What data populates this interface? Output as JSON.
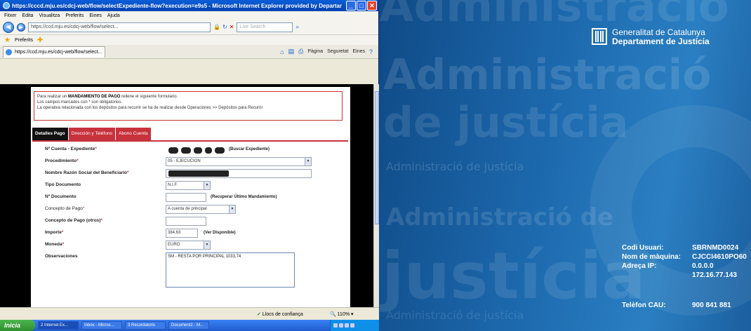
{
  "window": {
    "title": "https://cccd.mju.es/cdcj-web/flow/selectExpediente-flow?execution=e9s5 - Microsoft Internet Explorer provided by Departament de"
  },
  "menu": [
    "Fitxer",
    "Edita",
    "Visualitza",
    "Preferits",
    "Eines",
    "Ajuda"
  ],
  "address": {
    "url": "https://ccd.mju.es/cdcj-web/flow/select...",
    "search_placeholder": "Live Search"
  },
  "favorites": {
    "label": "Preferits"
  },
  "tab": {
    "label": "https://ccd.mju.es/cdcj-web/flow/select..."
  },
  "command_bar": {
    "page": "Pàgina",
    "security": "Seguretat",
    "tools": "Eines"
  },
  "notice": {
    "line1_pre": "Para realizar un",
    "line1_bold": "MANDAMIENTO DE PAGO",
    "line1_post": "rellene el siguiente formulario.",
    "line2": "Los campos marcados con * son obligatorios.",
    "line3": "La operativa relacionada con los depósitos para recurrir se ha de realizar desde Operaciones >> Depósitos para Recurrir"
  },
  "form_tabs": [
    "Detalles Pago",
    "Dirección y Teléfono",
    "Abono Cuenta"
  ],
  "form": {
    "cuenta_label": "Nº Cuenta - Expediente",
    "buscar_link": "(Buscar Expediente)",
    "procedimiento_label": "Procedimiento",
    "procedimiento_value": "05 - EJECUCION",
    "beneficiario_label": "Nombre Razón Social del Beneficiario",
    "tipo_doc_label": "Tipo Documento",
    "tipo_doc_value": "N.I.F.",
    "num_doc_label": "Nº Documento",
    "recuperar_link": "(Recuperar Último Mandamiento)",
    "concepto_label": "Concepto de Pago",
    "concepto_value": "A cuenta de principal",
    "concepto_otros_label": "Concepto de Pago (otros)",
    "importe_label": "Importe",
    "importe_value": "384,63",
    "ver_disponible_link": "(Ver Disponible)",
    "moneda_label": "Moneda",
    "moneda_value": "EURO",
    "observaciones_label": "Observaciones",
    "observaciones_value": "SM - RESTA POR PRINCIPAL 1033,74"
  },
  "status": {
    "zone": "Llocs de confiança",
    "zoom": "110%"
  },
  "taskbar": {
    "start": "Inicia",
    "tasks": [
      "2 Internet Ex...",
      "Inbox - Micros...",
      "3 Recordatoris",
      "Document2 - M..."
    ]
  },
  "desktop": {
    "gencat_line1": "Generalitat de Catalunya",
    "gencat_line2": "Departament de Justícia",
    "watermark_1": "Administració",
    "watermark_2": "Administració",
    "watermark_3": "de justícia",
    "watermark_4": "Administració de justícia",
    "watermark_5": "Administració de",
    "watermark_6": "justícia",
    "watermark_7": "Administració de justícia",
    "info": {
      "codi_usuari_label": "Codi Usuari:",
      "codi_usuari_value": "SBRNMD0024",
      "nom_maquina_label": "Nom de màquina:",
      "nom_maquina_value": "CJCCI4610PO60",
      "adreca_ip_label": "Adreça IP:",
      "adreca_ip_value1": "0.0.0.0",
      "adreca_ip_value2": "172.16.77.143",
      "telefon_cau_label": "Telèfon CAU:",
      "telefon_cau_value": "900 841 881"
    }
  }
}
